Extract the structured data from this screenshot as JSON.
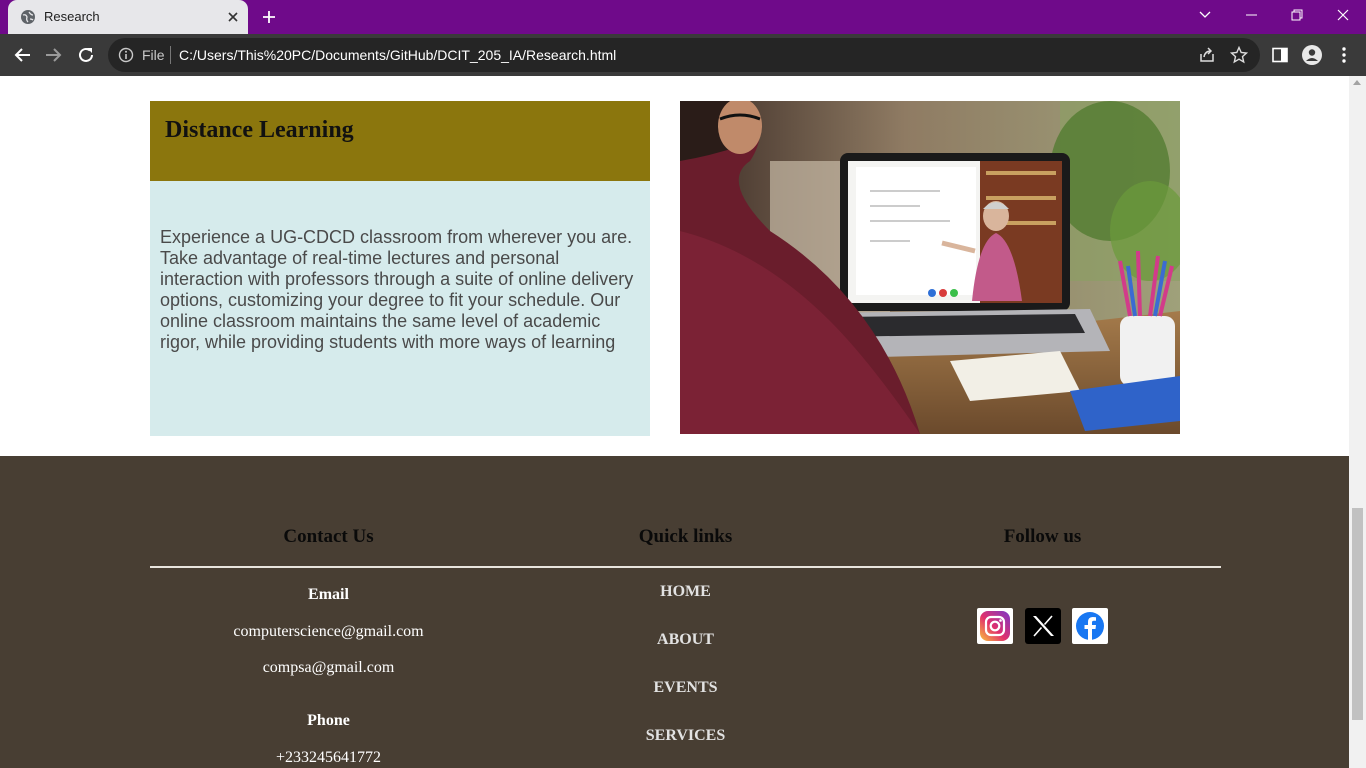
{
  "browser": {
    "tab_title": "Research",
    "file_label": "File",
    "url": "C:/Users/This%20PC/Documents/GitHub/DCIT_205_IA/Research.html",
    "theme_color": "#6f0a8a"
  },
  "card": {
    "title": "Distance Learning",
    "body": "Experience a UG-CDCD classroom from wherever you are. Take advantage of real-time lectures and personal interaction with professors through a suite of online delivery options, customizing your degree to fit your schedule. Our online classroom maintains the same level of academic rigor, while providing students with more ways of learning",
    "header_color": "#8b760d",
    "body_color": "#d6ebec"
  },
  "footer": {
    "background": "#483e33",
    "contact": {
      "heading": "Contact Us",
      "email_label": "Email",
      "emails": [
        "computerscience@gmail.com",
        "compsa@gmail.com"
      ],
      "phone_label": "Phone",
      "phone": "+233245641772"
    },
    "quick_links": {
      "heading": "Quick links",
      "items": [
        "HOME",
        "ABOUT",
        "EVENTS",
        "SERVICES"
      ]
    },
    "follow": {
      "heading": "Follow us",
      "icons": [
        "instagram-icon",
        "x-icon",
        "facebook-icon"
      ]
    }
  }
}
